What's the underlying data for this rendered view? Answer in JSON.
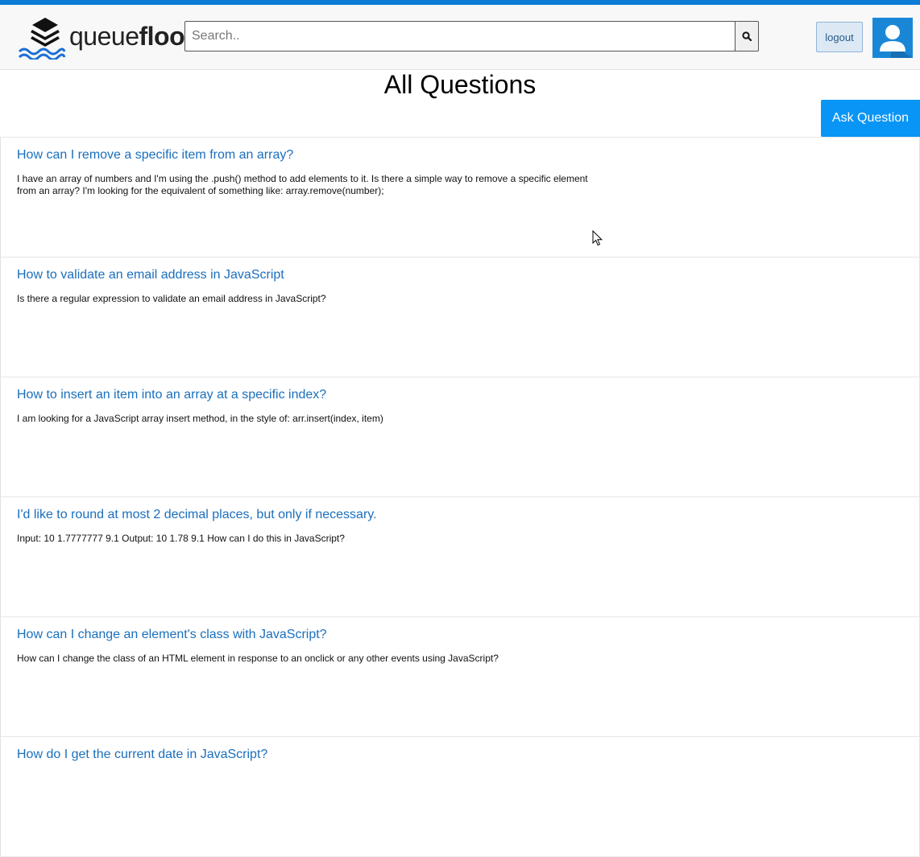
{
  "header": {
    "logo_light": "queue",
    "logo_bold": "flood",
    "search_placeholder": "Search..",
    "logout_label": "logout"
  },
  "page": {
    "title": "All Questions",
    "ask_label": "Ask Question"
  },
  "questions": [
    {
      "title": "How can I remove a specific item from an array?",
      "body": "I have an array of numbers and I'm using the .push() method to add elements to it. Is there a simple way to remove a specific element from an array? I'm looking for the equivalent of something like: array.remove(number);"
    },
    {
      "title": "How to validate an email address in JavaScript",
      "body": "Is there a regular expression to validate an email address in JavaScript?"
    },
    {
      "title": "How to insert an item into an array at a specific index?",
      "body": "I am looking for a JavaScript array insert method, in the style of: arr.insert(index, item)"
    },
    {
      "title": "I'd like to round at most 2 decimal places, but only if necessary.",
      "body": "Input: 10 1.7777777 9.1 Output: 10 1.78 9.1 How can I do this in JavaScript?"
    },
    {
      "title": "How can I change an element's class with JavaScript?",
      "body": "How can I change the class of an HTML element in response to an onclick or any other events using JavaScript?"
    },
    {
      "title": "How do I get the current date in JavaScript?",
      "body": ""
    }
  ],
  "colors": {
    "accent": "#0a7cd6",
    "link": "#1a6fbd",
    "ask_button": "#0995f5",
    "avatar_bg": "#1a87d6"
  },
  "icons": {
    "logo": "stacked-layers-waves-icon",
    "search": "search-icon",
    "avatar": "user-silhouette-icon",
    "cursor": "mouse-pointer-icon"
  }
}
